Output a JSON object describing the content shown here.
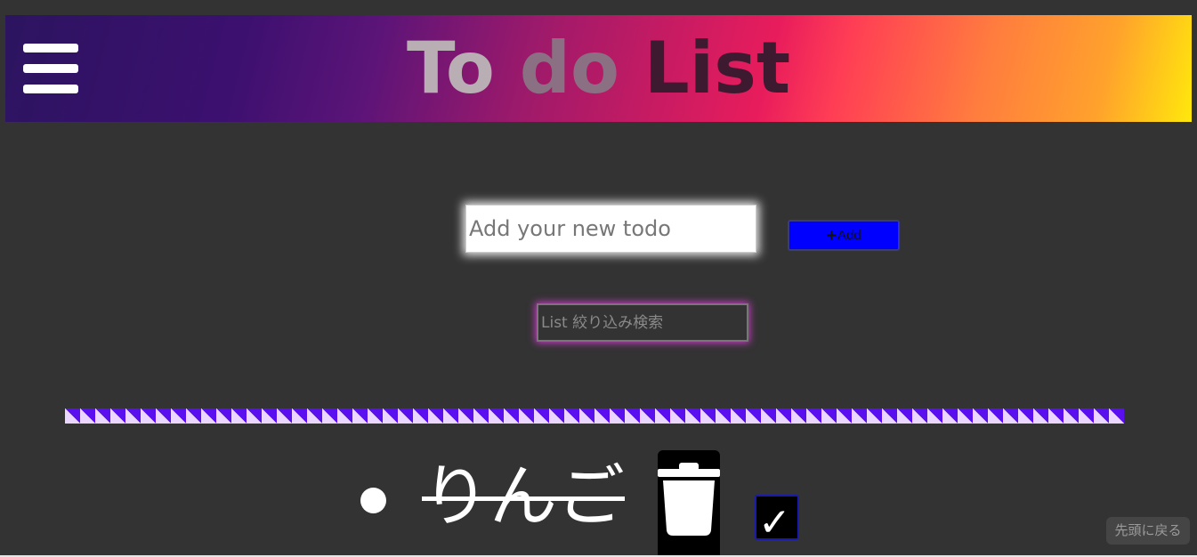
{
  "header": {
    "title_words": [
      "To",
      "do",
      "List"
    ],
    "menu_icon": "hamburger-menu-icon"
  },
  "todo_input": {
    "placeholder": "Add your new todo",
    "value": ""
  },
  "add_button": {
    "icon": "plus-icon",
    "icon_glyph": "+",
    "label": "Add"
  },
  "search": {
    "placeholder": "List 絞り込み検索",
    "value": ""
  },
  "todos": [
    {
      "text": "りんご",
      "completed": true,
      "delete_icon": "trash-icon",
      "check_icon": "checkmark-icon",
      "check_glyph": "✓"
    }
  ],
  "back_to_top": {
    "label": "先頭に戻る"
  },
  "colors": {
    "background": "#333333",
    "add_button": "#0000ff",
    "divider_stripe": "#5a10ee",
    "divider_light": "#ead6ff",
    "search_glow": "#d43cd0",
    "header_gradient": [
      "#2c1460",
      "#e81c5c",
      "#ffe80c"
    ]
  }
}
